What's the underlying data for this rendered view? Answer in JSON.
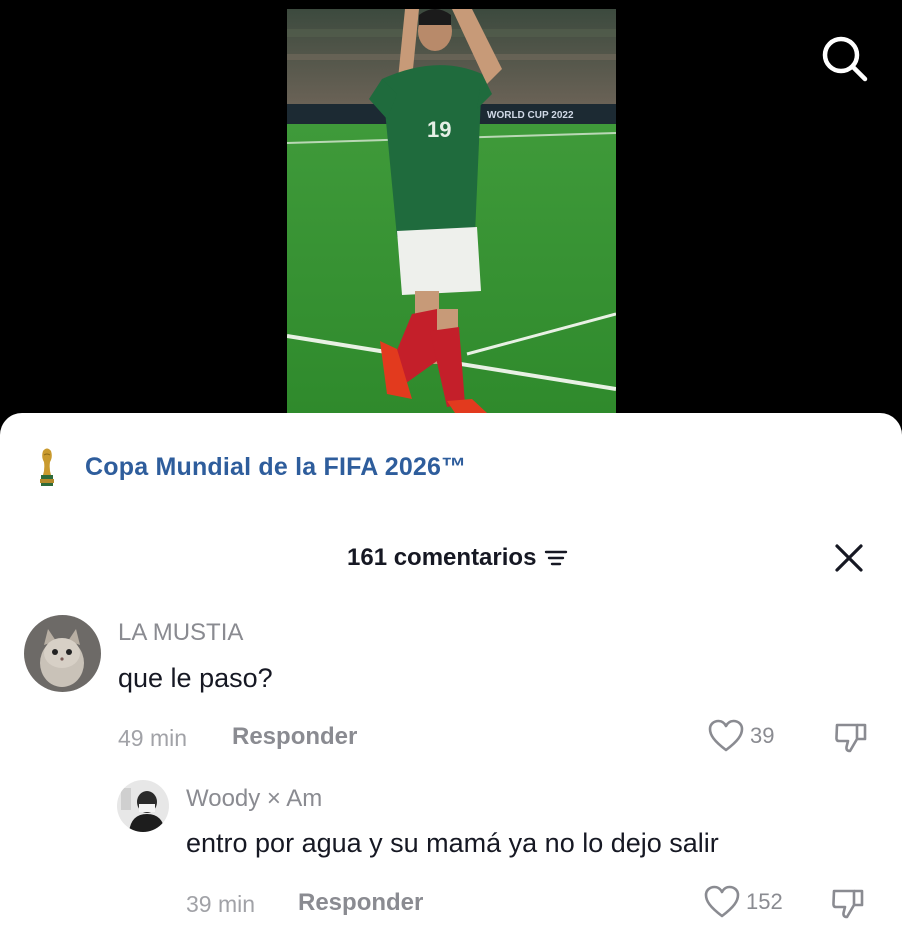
{
  "video": {
    "jersey_number": "19",
    "banner_text": "WORLD CUP 2022"
  },
  "topic": {
    "label": "Copa Mundial de la FIFA 2026™"
  },
  "comments_header": {
    "title": "161 comentarios"
  },
  "comments": [
    {
      "username": "LA MUSTIA",
      "text": "que le paso?",
      "time": "49 min",
      "reply_label": "Responder",
      "likes": "39"
    },
    {
      "username": "Woody × Am",
      "text": "entro por agua y su mamá ya no lo dejo salir",
      "time": "39 min",
      "reply_label": "Responder",
      "likes": "152"
    }
  ],
  "colors": {
    "topic_link": "#2e5d9c",
    "background_video": "#000000",
    "sheet": "#ffffff"
  }
}
